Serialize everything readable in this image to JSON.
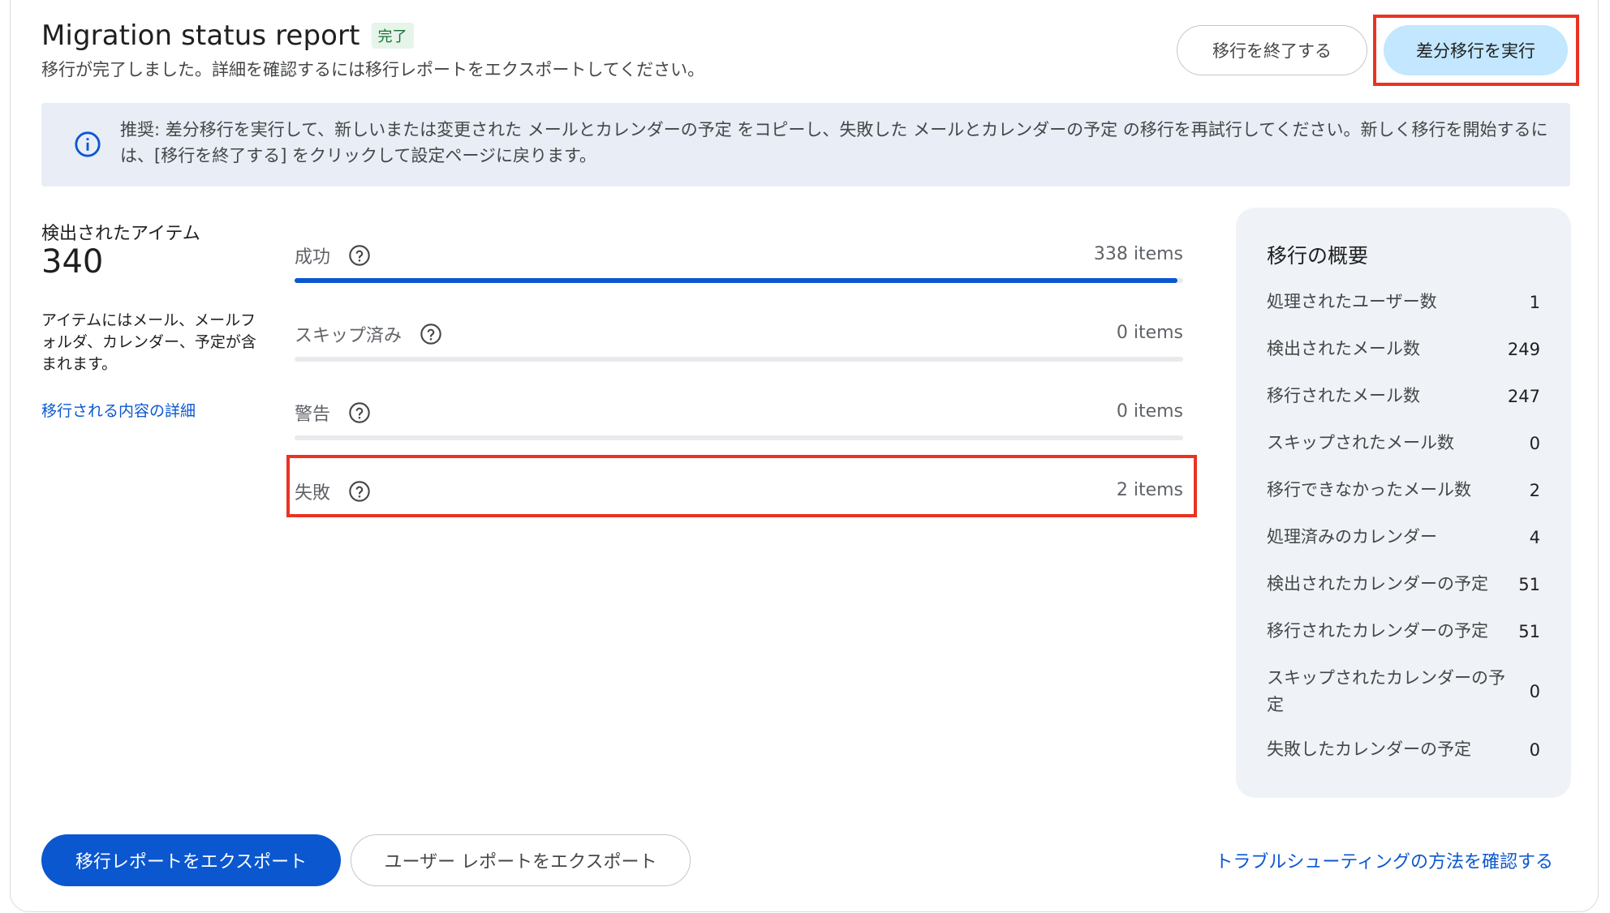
{
  "header": {
    "title": "Migration status report",
    "badge": "完了",
    "subtitle": "移行が完了しました。詳細を確認するには移行レポートをエクスポートしてください。",
    "end_button": "移行を終了する",
    "delta_button": "差分移行を実行"
  },
  "banner": {
    "icon": "info-icon",
    "text": "推奨: 差分移行を実行して、新しいまたは変更された メールとカレンダーの予定 をコピーし、失敗した メールとカレンダーの予定 の移行を再試行してください。新しく移行を開始するには、[移行を終了する] をクリックして設定ページに戻ります。"
  },
  "detected": {
    "label": "検出されたアイテム",
    "count": "340",
    "description": "アイテムにはメール、メールフォルダ、カレンダー、予定が含まれます。",
    "link": "移行される内容の詳細"
  },
  "stats": [
    {
      "label": "成功",
      "value": "338 items",
      "progress": 0.994
    },
    {
      "label": "スキップ済み",
      "value": "0 items",
      "progress": 0
    },
    {
      "label": "警告",
      "value": "0 items",
      "progress": 0
    },
    {
      "label": "失敗",
      "value": "2 items",
      "progress": 0
    }
  ],
  "summary": {
    "title": "移行の概要",
    "rows": [
      {
        "key": "処理されたユーザー数",
        "value": "1"
      },
      {
        "key": "検出されたメール数",
        "value": "249"
      },
      {
        "key": "移行されたメール数",
        "value": "247"
      },
      {
        "key": "スキップされたメール数",
        "value": "0"
      },
      {
        "key": "移行できなかったメール数",
        "value": "2"
      },
      {
        "key": "処理済みのカレンダー",
        "value": "4"
      },
      {
        "key": "検出されたカレンダーの予定",
        "value": "51"
      },
      {
        "key": "移行されたカレンダーの予定",
        "value": "51"
      },
      {
        "key": "スキップされたカレンダーの予定",
        "value": "0"
      },
      {
        "key": "失敗したカレンダーの予定",
        "value": "0"
      }
    ]
  },
  "footer": {
    "export_button": "移行レポートをエクスポート",
    "user_export_button": "ユーザー レポートをエクスポート",
    "troubleshoot_link": "トラブルシューティングの方法を確認する"
  },
  "colors": {
    "primary": "#0b57d0",
    "highlight": "#ea3323",
    "tonal": "#c2e7ff"
  }
}
